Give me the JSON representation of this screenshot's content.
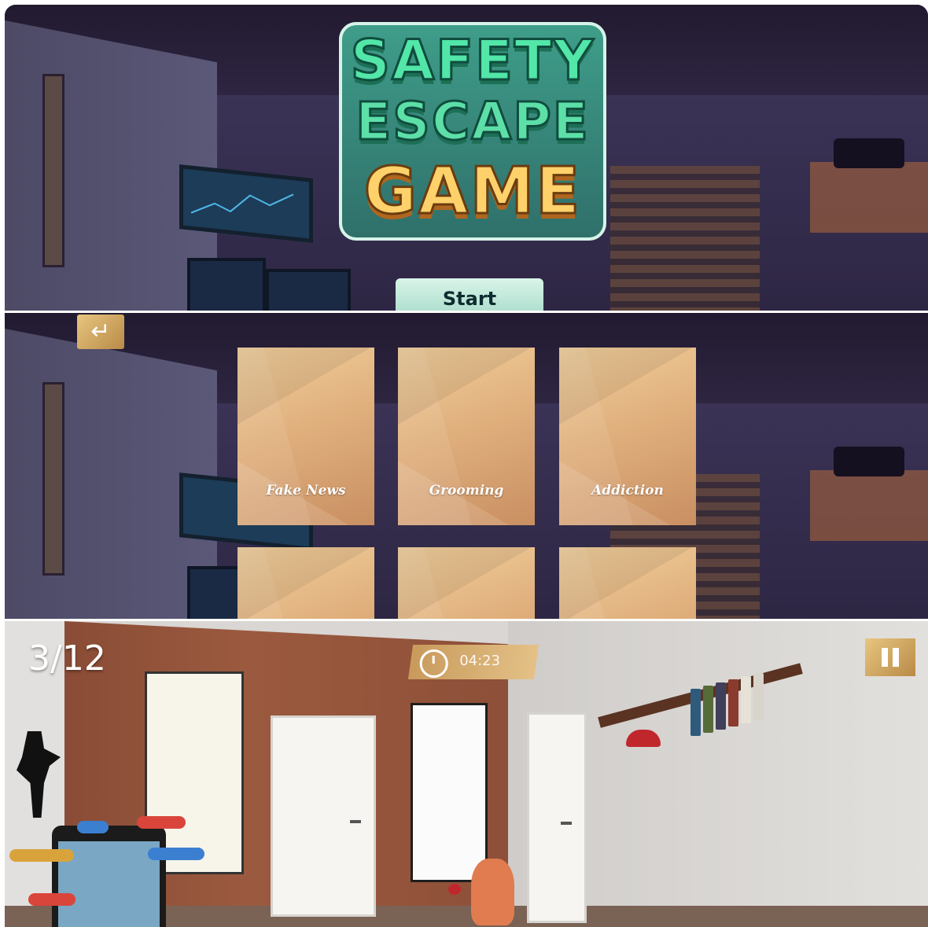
{
  "title": {
    "line1": "SAFETY",
    "line2": "ESCAPE",
    "line3": "GAME"
  },
  "start_screen": {
    "start_label": "Start"
  },
  "category_screen": {
    "back_icon": "return-arrow-icon",
    "cards": [
      {
        "label": "Fake News"
      },
      {
        "label": "Grooming"
      },
      {
        "label": "Addiction"
      },
      {
        "label": ""
      },
      {
        "label": ""
      },
      {
        "label": ""
      }
    ]
  },
  "game_hud": {
    "level_counter": "3/12",
    "timer": "04:23",
    "timer_icon": "alarm-clock-icon",
    "pause_icon": "pause-icon"
  },
  "colors": {
    "title_green": "#52e6a8",
    "title_gold": "#ffd16a",
    "button_gold": "#d9b06a",
    "card_tan": "#e0b07d"
  }
}
